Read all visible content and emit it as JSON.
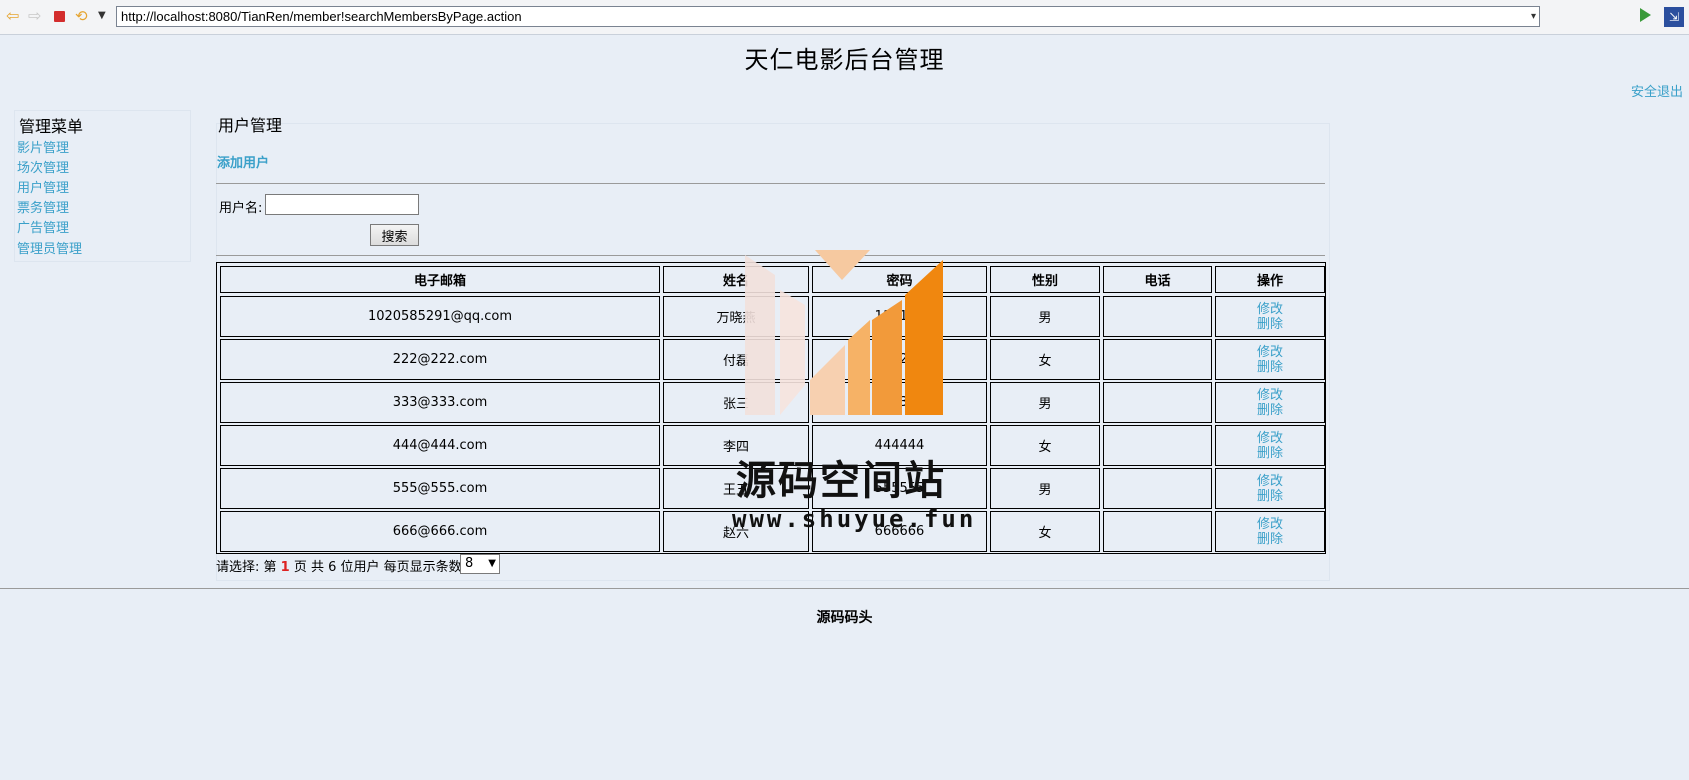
{
  "browser": {
    "url": "http://localhost:8080/TianRen/member!searchMembersByPage.action"
  },
  "site": {
    "title": "天仁电影后台管理",
    "logout": "安全退出"
  },
  "sidebar": {
    "title": "管理菜单",
    "items": [
      {
        "label": "影片管理"
      },
      {
        "label": "场次管理"
      },
      {
        "label": "用户管理"
      },
      {
        "label": "票务管理"
      },
      {
        "label": "广告管理"
      },
      {
        "label": "管理员管理"
      }
    ]
  },
  "main": {
    "title": "用户管理",
    "add_user": "添加用户",
    "search": {
      "label": "用户名:",
      "value": "",
      "button": "搜索"
    },
    "table": {
      "headers": [
        "电子邮箱",
        "姓名",
        "密码",
        "性别",
        "电话",
        "操作"
      ],
      "rows": [
        {
          "email": "1020585291@qq.com",
          "name": "万晓燕",
          "password": "111111",
          "gender": "男",
          "phone": ""
        },
        {
          "email": "222@222.com",
          "name": "付磊",
          "password": "222222",
          "gender": "女",
          "phone": ""
        },
        {
          "email": "333@333.com",
          "name": "张三",
          "password": "333333",
          "gender": "男",
          "phone": ""
        },
        {
          "email": "444@444.com",
          "name": "李四",
          "password": "444444",
          "gender": "女",
          "phone": ""
        },
        {
          "email": "555@555.com",
          "name": "王五",
          "password": "555555",
          "gender": "男",
          "phone": ""
        },
        {
          "email": "666@666.com",
          "name": "赵六",
          "password": "666666",
          "gender": "女",
          "phone": ""
        }
      ],
      "ops": {
        "edit": "修改",
        "delete": "删除"
      }
    },
    "pager": {
      "prefix": "请选择: 第",
      "current": "1",
      "middle": "页 共 6 位用户 每页显示条数:",
      "page_size": "8"
    }
  },
  "footer": {
    "text": "源码码头"
  },
  "watermark": {
    "text": "源码空间站",
    "url": "www.shuyue.fun"
  }
}
